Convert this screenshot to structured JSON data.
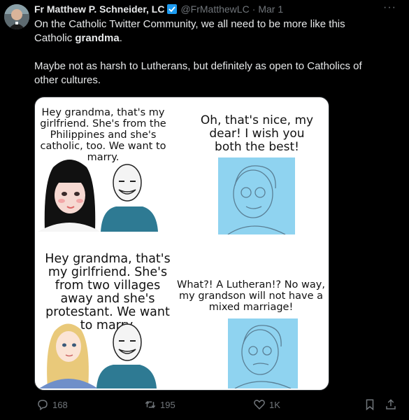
{
  "author": {
    "name": "Fr Matthew P. Schneider, LC",
    "handle": "@FrMatthewLC",
    "separator": "·",
    "date": "Mar 1",
    "verified_icon": "verified-badge-icon"
  },
  "tweet": {
    "line1_a": "On the Catholic Twitter Community, we all need to be more like this",
    "line1_b": "Catholic ",
    "line1_bold": "grandma",
    "line1_end": ".",
    "line2": "Maybe not as harsh to Lutherans, but definitely as open to Catholics of other cultures."
  },
  "meme": {
    "panel1_caption": "Hey grandma, that's my girlfriend. She's from the Philippines and she's catholic, too. We want to marry.",
    "panel2_caption": "Oh, that's nice, my dear! I wish you both the best!",
    "panel3_caption": "Hey grandma, that's my girlfriend. She's from two villages away and she's protestant. We want to marry.",
    "panel4_caption": "What?! A Lutheran!? No way, my grandson will not have a mixed marriage!"
  },
  "actions": {
    "replies": "168",
    "reposts": "195",
    "likes": "1K"
  },
  "colors": {
    "background": "#000000",
    "text": "#e7e9ea",
    "muted": "#71767b",
    "verified": "#1d9bf0",
    "grandma_panel": "#8fd3f0"
  }
}
